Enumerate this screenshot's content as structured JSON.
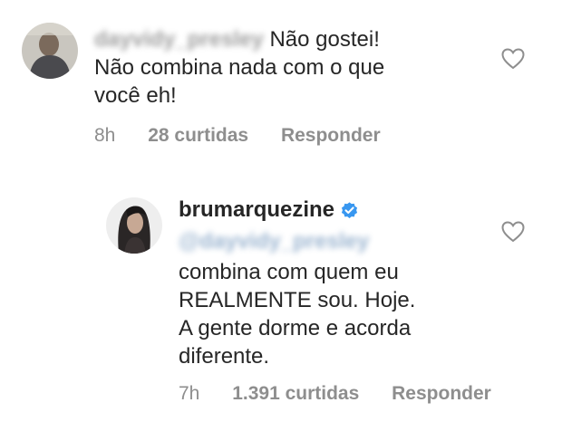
{
  "comment": {
    "username": "dayvidy_presley",
    "text_line1": "Não gostei!",
    "text_line2": "Não combina nada com o que",
    "text_line3": "você eh!",
    "time": "8h",
    "likes": "28 curtidas",
    "reply_label": "Responder",
    "avatar_icon": "user-avatar",
    "like_icon": "heart-outline-icon"
  },
  "reply": {
    "username": "brumarquezine",
    "verified_icon": "verified-badge-icon",
    "verified_color": "#3897f0",
    "mention": "@dayvidy_presley",
    "text_line1": "combina com quem eu",
    "text_line2": "REALMENTE sou. Hoje.",
    "text_line3": "A gente dorme e acorda",
    "text_line4": "diferente.",
    "time": "7h",
    "likes": "1.391 curtidas",
    "reply_label": "Responder",
    "avatar_icon": "user-avatar",
    "like_icon": "heart-outline-icon"
  }
}
